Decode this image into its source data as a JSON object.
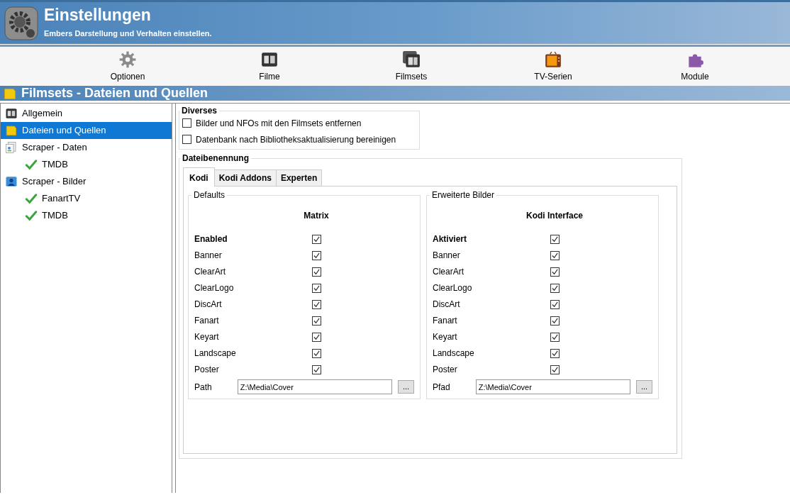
{
  "header": {
    "title": "Einstellungen",
    "subtitle": "Embers Darstellung und Verhalten einstellen."
  },
  "toolbar": [
    {
      "label": "Optionen",
      "kind": "gear"
    },
    {
      "label": "Filme",
      "kind": "film"
    },
    {
      "label": "Filmsets",
      "kind": "filmsets"
    },
    {
      "label": "TV-Serien",
      "kind": "tv"
    },
    {
      "label": "Module",
      "kind": "puzzle"
    }
  ],
  "section_title": "Filmsets - Dateien und Quellen",
  "sidebar": {
    "items": [
      {
        "label": "Allgemein",
        "kind": "film",
        "selected": false
      },
      {
        "label": "Dateien und Quellen",
        "kind": "folder",
        "selected": true
      },
      {
        "label": "Scraper - Daten",
        "kind": "data",
        "selected": false,
        "children": [
          {
            "label": "TMDB",
            "kind": "check",
            "selected": false
          }
        ]
      },
      {
        "label": "Scraper - Bilder",
        "kind": "images",
        "selected": false,
        "children": [
          {
            "label": "FanartTV",
            "kind": "check",
            "selected": false
          },
          {
            "label": "TMDB",
            "kind": "check",
            "selected": false
          }
        ]
      }
    ]
  },
  "misc": {
    "title": "Diverses",
    "options": [
      {
        "label": "Bilder und NFOs mit den Filmsets entfernen",
        "checked": false
      },
      {
        "label": "Datenbank nach Bibliotheksaktualisierung bereinigen",
        "checked": false
      }
    ]
  },
  "naming": {
    "title": "Dateibenennung",
    "tabs": [
      {
        "label": "Kodi",
        "selected": true
      },
      {
        "label": "Kodi Addons",
        "selected": false
      },
      {
        "label": "Experten",
        "selected": false
      }
    ],
    "groups": [
      {
        "title": "Defaults",
        "column": "Matrix",
        "path_label": "Path",
        "path": "Z:\\Media\\Cover",
        "browse": "...",
        "rows": [
          {
            "label": "Enabled",
            "kind": "master",
            "checked": true
          },
          {
            "label": "Banner",
            "kind": "image",
            "checked": true
          },
          {
            "label": "ClearArt",
            "kind": "image",
            "checked": true
          },
          {
            "label": "ClearLogo",
            "kind": "image",
            "checked": true
          },
          {
            "label": "DiscArt",
            "kind": "image",
            "checked": true
          },
          {
            "label": "Fanart",
            "kind": "image",
            "checked": true
          },
          {
            "label": "Keyart",
            "kind": "image",
            "checked": true
          },
          {
            "label": "Landscape",
            "kind": "image",
            "checked": true
          },
          {
            "label": "Poster",
            "kind": "image",
            "checked": true
          }
        ]
      },
      {
        "title": "Erweiterte Bilder",
        "column": "Kodi Interface",
        "path_label": "Pfad",
        "path": "Z:\\Media\\Cover",
        "browse": "...",
        "rows": [
          {
            "label": "Aktiviert",
            "kind": "master",
            "checked": true
          },
          {
            "label": "Banner",
            "kind": "image",
            "checked": true
          },
          {
            "label": "ClearArt",
            "kind": "image",
            "checked": true
          },
          {
            "label": "ClearLogo",
            "kind": "image",
            "checked": true
          },
          {
            "label": "DiscArt",
            "kind": "image",
            "checked": true
          },
          {
            "label": "Fanart",
            "kind": "image",
            "checked": true
          },
          {
            "label": "Keyart",
            "kind": "image",
            "checked": true
          },
          {
            "label": "Landscape",
            "kind": "image",
            "checked": true
          },
          {
            "label": "Poster",
            "kind": "image",
            "checked": true
          }
        ]
      }
    ]
  }
}
